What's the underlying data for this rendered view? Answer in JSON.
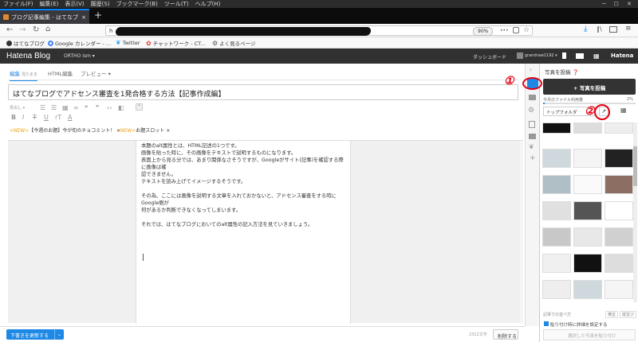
{
  "menu": [
    "ファイル(F)",
    "編集(E)",
    "表示(V)",
    "履歴(S)",
    "ブックマーク(B)",
    "ツール(T)",
    "ヘルプ(H)"
  ],
  "browser": {
    "tab_title": "ブログ記事編集 - はてなブログ",
    "tab_close": "×",
    "new_tab": "+",
    "url_prefix": "h",
    "zoom": "90%",
    "ellipsis": "•••"
  },
  "bookmarks": [
    "はてなブログ",
    "Google カレンダー - ...",
    "Twitter",
    "チャットワーク - CT...",
    "よく見るページ"
  ],
  "hatena": {
    "logo": "Hatena Blog",
    "blog_name": "ORTHO ism ▾",
    "dashboard": "ダッシュボード",
    "user": "grandraw1192 ▾",
    "right_logo": "Hatena"
  },
  "editor": {
    "tabs": [
      "編集",
      "見たまま",
      "HTML編集",
      "プレビュー"
    ],
    "title": "はてなブログでアドセンス審査を1発合格する方法【記事作成編】",
    "toolbar_font": "見出し",
    "notices": [
      {
        "badge": "<NEW>",
        "text": "【今週のお題】今が旬のチョコミント！",
        "close": "×"
      },
      {
        "badge": "<NEW>",
        "text": "お題スロット",
        "close": "×"
      }
    ],
    "body_lines": [
      "本題のalt属性とは、HTML記述の1つです。",
      "画像を貼った時に、その画像をテキストで説明するものになります。",
      "表面上から見る分では、あまり関係なさそうですが、Googleがサイト(記事)を確認する際に画像は確",
      "認できません。",
      "テキストを読み上げてイメージするそうです。",
      "",
      "その為、ここには画像を説明する文章を入れておかないと、アドセンス審査をする時にGoogle側が",
      "何があるか判断できなくなってしまいます。",
      "",
      "それでは、はてなブログにおいてのalt属性の記入方法を見ていきましょう。"
    ],
    "update_button": "下書きを更新する",
    "char_count": "2312文字",
    "delete_button": "削除する"
  },
  "photo_panel": {
    "title": "写真を投稿",
    "upload_button": "+ 写真を投稿",
    "usage_label": "今月のファイル利用量",
    "usage_percent": "2%",
    "usage_fraction": 0.02,
    "folder": "トップフォルダ",
    "sort_label": "記事での並べ方",
    "sort_options": [
      "横並",
      "縦並び"
    ],
    "checkbox_label": "貼り付け時に詳細を設定する",
    "paste_button": "選択した写真を貼り付け"
  },
  "annotations": [
    "①",
    "②"
  ],
  "colors": {
    "accent": "#1e88e5",
    "hatena_header": "#313131",
    "annotation_red": "#e60012",
    "notice_orange": "#e8a317"
  }
}
